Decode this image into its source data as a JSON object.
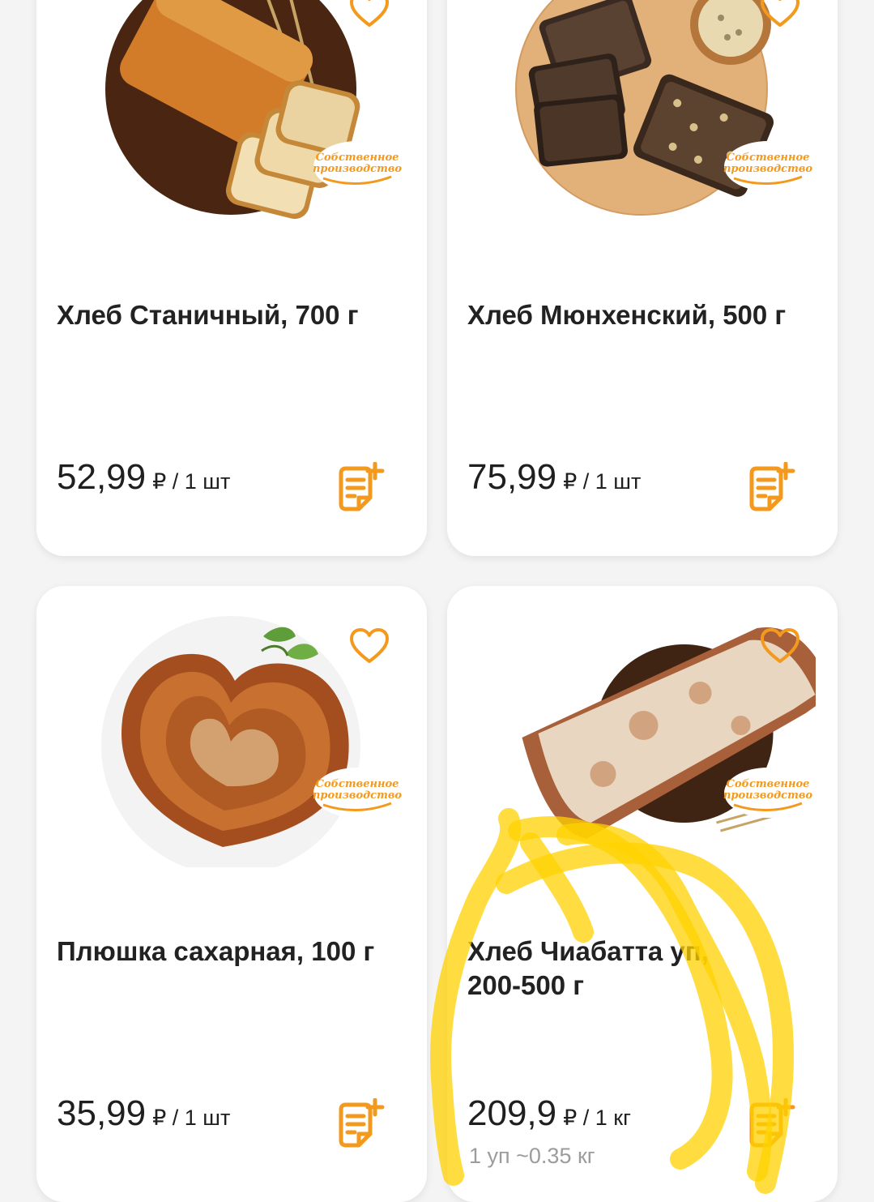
{
  "colors": {
    "accent": "#f39a1e",
    "card_bg": "#ffffff",
    "page_bg": "#f4f4f4",
    "text": "#222222",
    "muted": "#9c9c9c",
    "highlighter": "#ffd200"
  },
  "icons": {
    "favorite": "heart-outline-icon",
    "add_to_list": "list-add-icon"
  },
  "products": [
    {
      "title": "Хлеб Станичный, 700 г",
      "price": "52,99",
      "unit": "₽ / 1 шт",
      "badge_line1": "Собственное",
      "badge_line2": "производство",
      "image": "white-bread-loaf-on-board"
    },
    {
      "title": "Хлеб Мюнхенский, 500 г",
      "price": "75,99",
      "unit": "₽ / 1 шт",
      "badge_line1": "Собственное",
      "badge_line2": "производство",
      "image": "dark-seeded-bread-slices"
    },
    {
      "title": "Плюшка сахарная, 100 г",
      "price": "35,99",
      "unit": "₽ / 1 шт",
      "badge_line1": "Собственное",
      "badge_line2": "производство",
      "image": "heart-shaped-sugar-bun"
    },
    {
      "title": "Хлеб Чиабатта уп, 200-500 г",
      "price": "209,9",
      "unit": "₽ / 1 кг",
      "pack_info": "1 уп ~0.35 кг",
      "badge_line1": "Собственное",
      "badge_line2": "производство",
      "image": "ciabatta-loaf"
    }
  ]
}
